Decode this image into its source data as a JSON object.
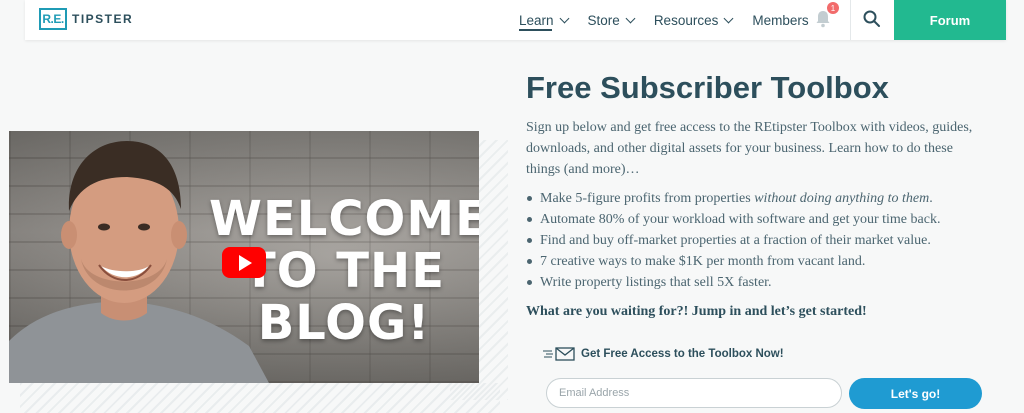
{
  "header": {
    "logo_mark": "R.E.",
    "logo_text": "TIPSTER",
    "nav": [
      {
        "label": "Learn",
        "has_dropdown": true,
        "active": true
      },
      {
        "label": "Store",
        "has_dropdown": true,
        "active": false
      },
      {
        "label": "Resources",
        "has_dropdown": true,
        "active": false
      },
      {
        "label": "Members",
        "has_dropdown": false,
        "active": false
      }
    ],
    "notification_count": "1",
    "forum_label": "Forum",
    "colors": {
      "brand": "#1f9bb5",
      "forum": "#22b990",
      "text": "#2d4f5c"
    }
  },
  "video": {
    "lines": [
      "WELCOME",
      "TO THE",
      "BLOG!"
    ],
    "play_icon": "youtube-play-icon"
  },
  "main": {
    "title": "Free Subscriber Toolbox",
    "intro": "Sign up below and get free access to the REtipster Toolbox with videos, guides, downloads, and other digital assets for your business. Learn how to do these things (and more)…",
    "bullets": [
      {
        "text": "Make 5-figure profits from properties ",
        "emphasis": "without doing anything to them",
        "after": "."
      },
      {
        "text": "Automate 80% of your workload with software and get your time back.",
        "emphasis": "",
        "after": ""
      },
      {
        "text": "Find and buy off-market properties at a fraction of their market value.",
        "emphasis": "",
        "after": ""
      },
      {
        "text": "7 creative ways to make $1K per month from vacant land.",
        "emphasis": "",
        "after": ""
      },
      {
        "text": "Write property listings that sell 5X faster.",
        "emphasis": "",
        "after": ""
      }
    ],
    "cta": "What are you waiting for?! Jump in and let’s get started!",
    "form": {
      "heading": "Get Free Access to the Toolbox Now!",
      "email_placeholder": "Email Address",
      "email_value": "",
      "submit_label": "Let's go!",
      "submit_color": "#1f9bd2"
    }
  }
}
